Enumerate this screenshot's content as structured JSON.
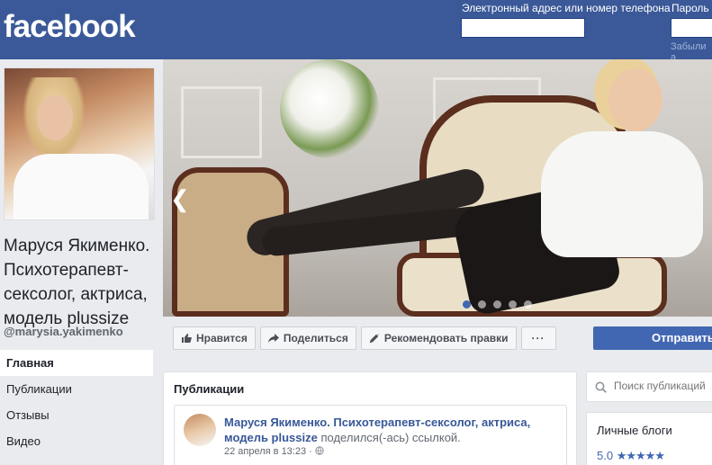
{
  "header": {
    "logo": "facebook",
    "email_label": "Электронный адрес или номер телефона",
    "password_label": "Пароль",
    "forgot_link": "Забыли а"
  },
  "sidebar": {
    "page_name": "Маруся Якименко. Психотерапевт-сексолог, актриса, модель plussize",
    "handle": "@marysia.yakimenko",
    "nav_items": [
      {
        "label": "Главная",
        "active": true
      },
      {
        "label": "Публикации",
        "active": false
      },
      {
        "label": "Отзывы",
        "active": false
      },
      {
        "label": "Видео",
        "active": false
      }
    ]
  },
  "cover": {
    "slides": 5,
    "active_slide": 1
  },
  "actions": {
    "like": "Нравится",
    "share": "Поделиться",
    "suggest": "Рекомендовать правки",
    "more": "···",
    "send": "Отправить"
  },
  "publications": {
    "title": "Публикации",
    "post": {
      "author": "Маруся Якименко. Психотерапевт-сексолог, актриса, модель plussize",
      "action": "поделился(-ась) ссылкой.",
      "date": "22 апреля в 13:23",
      "separator": "·"
    }
  },
  "right": {
    "search_placeholder": "Поиск публикаций",
    "category": "Личные блоги",
    "rating": "5.0",
    "stars": "★★★★★"
  },
  "colors": {
    "brand": "#3b5998",
    "accent": "#4267b2",
    "link": "#385898"
  }
}
